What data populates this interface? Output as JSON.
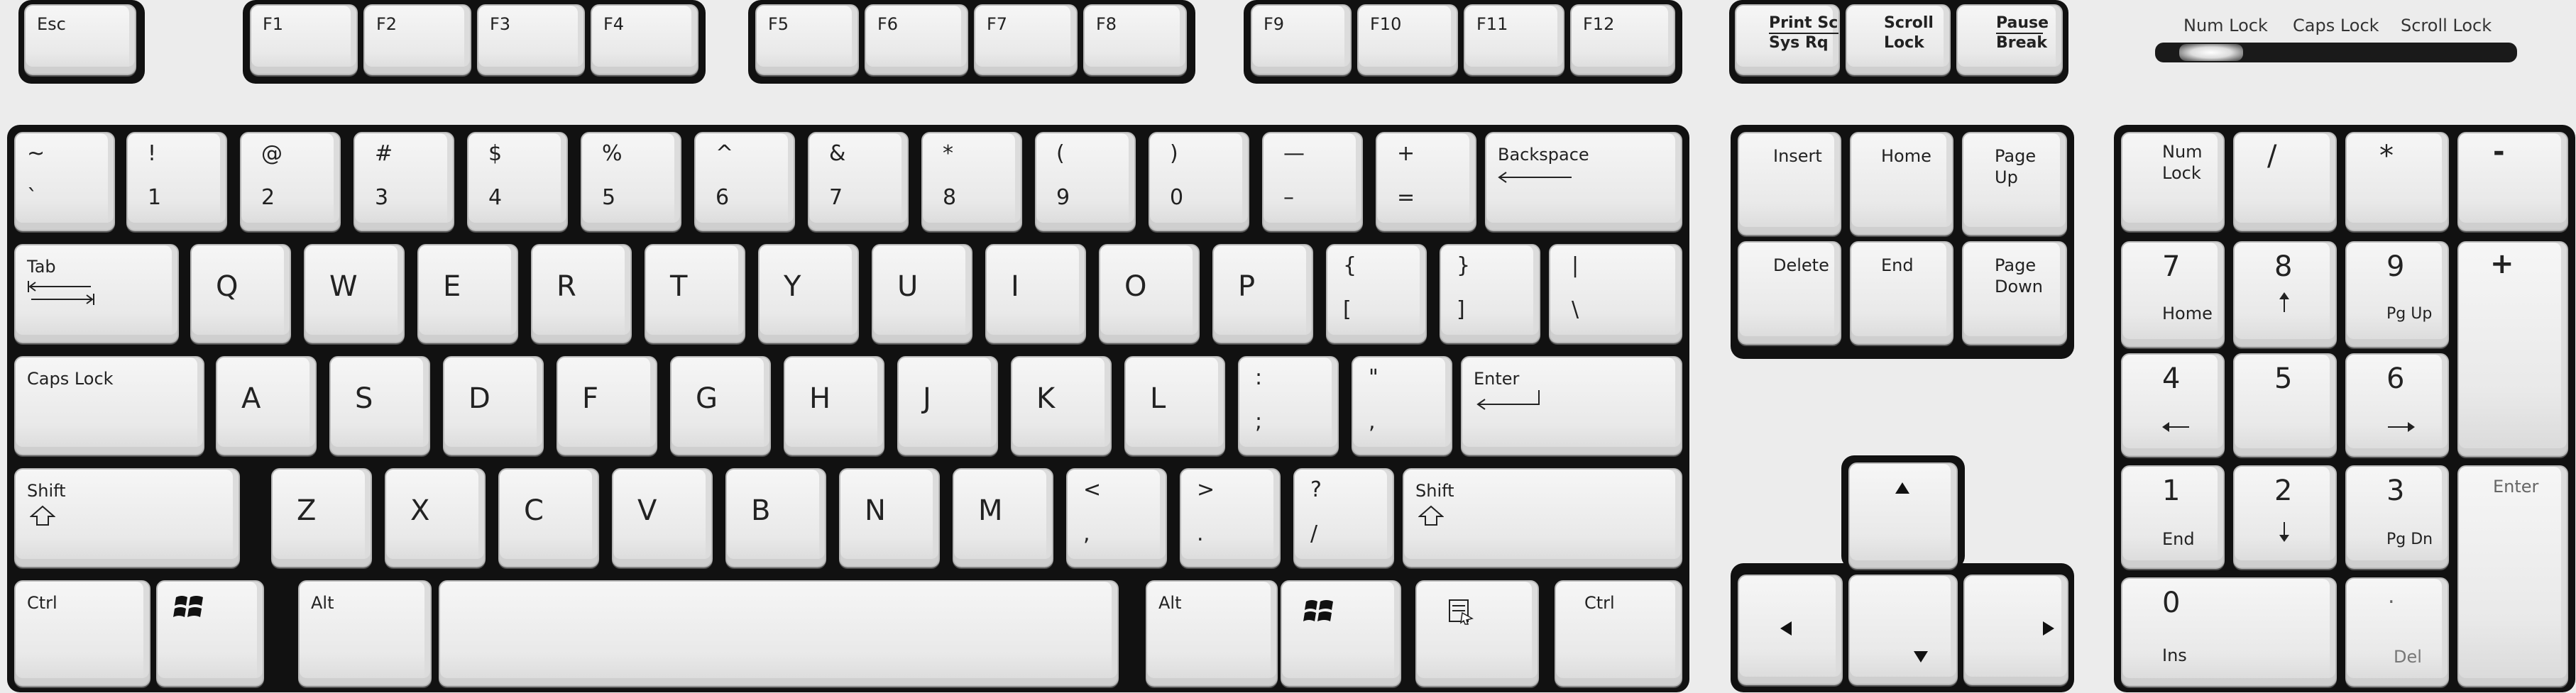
{
  "esc": "Esc",
  "f": [
    "F1",
    "F2",
    "F3",
    "F4",
    "F5",
    "F6",
    "F7",
    "F8",
    "F9",
    "F10",
    "F11",
    "F12"
  ],
  "sys": {
    "print_top": "Print Scr",
    "print_bot": "Sys Rq",
    "scroll_top": "Scroll",
    "scroll_bot": "Lock",
    "pause_top": "Pause",
    "pause_bot": "Break"
  },
  "leds": [
    "Num Lock",
    "Caps Lock",
    "Scroll Lock"
  ],
  "num_row": [
    {
      "top": "~",
      "bot": "`"
    },
    {
      "top": "!",
      "bot": "1"
    },
    {
      "top": "@",
      "bot": "2"
    },
    {
      "top": "#",
      "bot": "3"
    },
    {
      "top": "$",
      "bot": "4"
    },
    {
      "top": "%",
      "bot": "5"
    },
    {
      "top": "^",
      "bot": "6"
    },
    {
      "top": "&",
      "bot": "7"
    },
    {
      "top": "*",
      "bot": "8"
    },
    {
      "top": "(",
      "bot": "9"
    },
    {
      "top": ")",
      "bot": "0"
    },
    {
      "top": "—",
      "bot": "–"
    },
    {
      "top": "+",
      "bot": "="
    }
  ],
  "backspace": "Backspace",
  "tab": "Tab",
  "qrow": [
    "Q",
    "W",
    "E",
    "R",
    "T",
    "Y",
    "U",
    "I",
    "O",
    "P"
  ],
  "qrow_sym": [
    {
      "top": "{",
      "bot": "["
    },
    {
      "top": "}",
      "bot": "]"
    },
    {
      "top": "|",
      "bot": "\\"
    }
  ],
  "caps": "Caps Lock",
  "arow": [
    "A",
    "S",
    "D",
    "F",
    "G",
    "H",
    "J",
    "K",
    "L"
  ],
  "arow_sym": [
    {
      "top": ":",
      "bot": ";"
    },
    {
      "top": "\"",
      "bot": ","
    }
  ],
  "enter": "Enter",
  "shift": "Shift",
  "zrow": [
    "Z",
    "X",
    "C",
    "V",
    "B",
    "N",
    "M"
  ],
  "zrow_sym": [
    {
      "top": "<",
      "bot": ","
    },
    {
      "top": ">",
      "bot": "."
    },
    {
      "top": "?",
      "bot": "/"
    }
  ],
  "ctrl": "Ctrl",
  "alt": "Alt",
  "nav": {
    "insert": "Insert",
    "home": "Home",
    "page_up_1": "Page",
    "page_up_2": "Up",
    "delete": "Delete",
    "end": "End",
    "page_down_1": "Page",
    "page_down_2": "Down"
  },
  "numpad": {
    "numlock_1": "Num",
    "numlock_2": "Lock",
    "slash": "/",
    "star": "*",
    "minus": "-",
    "plus": "+",
    "n7": "7",
    "n7b": "Home",
    "n8": "8",
    "n9": "9",
    "n9b": "Pg Up",
    "n4": "4",
    "n5": "5",
    "n6": "6",
    "n1": "1",
    "n1b": "End",
    "n2": "2",
    "n3": "3",
    "n3b": "Pg Dn",
    "n0": "0",
    "n0b": "Ins",
    "dot": ".",
    "dotb": "Del",
    "enter": "Enter"
  }
}
